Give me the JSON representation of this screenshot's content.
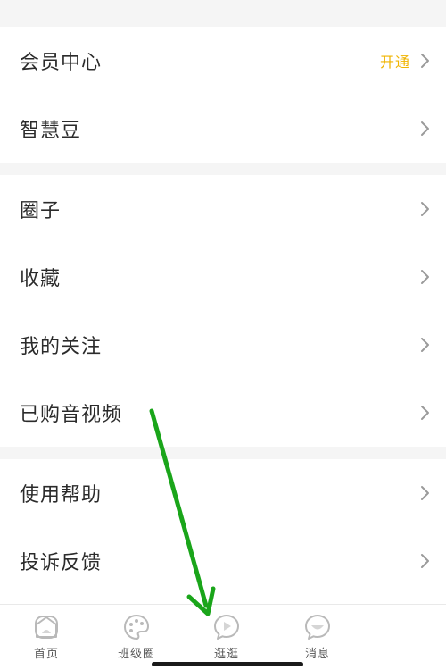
{
  "groups": [
    {
      "items": [
        {
          "label": "会员中心",
          "value": "开通"
        },
        {
          "label": "智慧豆",
          "value": ""
        }
      ]
    },
    {
      "items": [
        {
          "label": "圈子",
          "value": ""
        },
        {
          "label": "收藏",
          "value": ""
        },
        {
          "label": "我的关注",
          "value": ""
        },
        {
          "label": "已购音视频",
          "value": ""
        }
      ]
    },
    {
      "items": [
        {
          "label": "使用帮助",
          "value": ""
        },
        {
          "label": "投诉反馈",
          "value": ""
        }
      ]
    }
  ],
  "tabbar": {
    "tabs": [
      {
        "label": "首页",
        "icon": "home-icon"
      },
      {
        "label": "班级圈",
        "icon": "palette-icon"
      },
      {
        "label": "逛逛",
        "icon": "play-bubble-icon"
      },
      {
        "label": "消息",
        "icon": "chat-bubble-icon"
      }
    ]
  },
  "colors": {
    "accent": "#f0b400",
    "annotation_arrow": "#1aa51a"
  }
}
